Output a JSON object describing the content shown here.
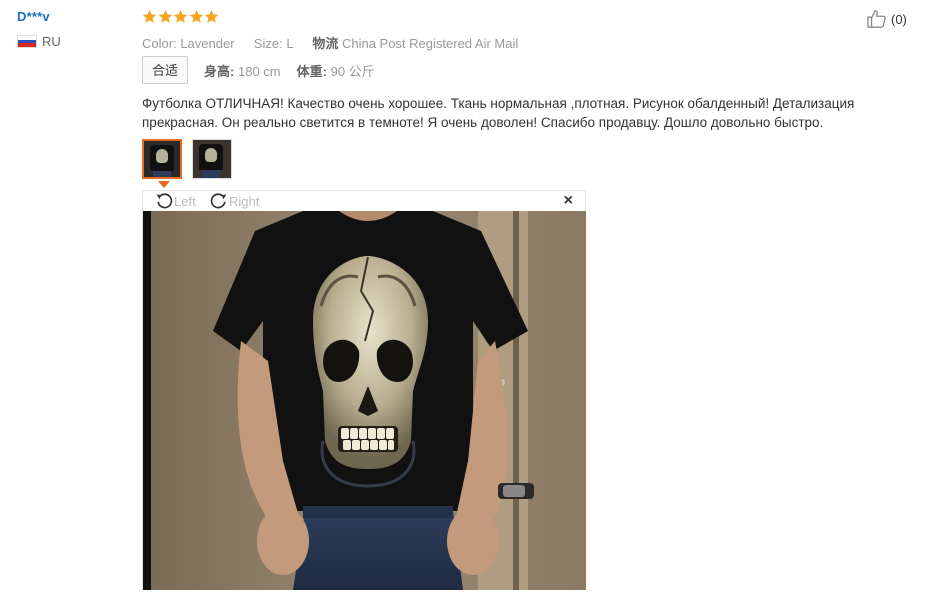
{
  "reviewer": {
    "name": "D***v",
    "country": "RU"
  },
  "rating": {
    "stars": 5,
    "color": "#f5a623"
  },
  "meta": {
    "color_label": "Color:",
    "color_value": "Lavender",
    "size_label": "Size:",
    "size_value": "L",
    "shipping_label": "物流",
    "shipping_value": "China Post Registered Air Mail"
  },
  "fit": {
    "tag": "合适",
    "height_label": "身高:",
    "height_value": "180 cm",
    "weight_label": "体重:",
    "weight_value": "90 公斤"
  },
  "helpful": {
    "count": "(0)"
  },
  "review_text": "Футболка ОТЛИЧНАЯ! Качество очень хорошее. Ткань нормальная ,плотная. Рисунок обалденный! Детализация прекрасная. Он реально светится в темноте! Я очень доволен! Спасибо продавцу. Дошло довольно быстро.",
  "viewer": {
    "rotate_left": "Left",
    "rotate_right": "Right",
    "close": "×"
  },
  "accent_color": "#e76a1f"
}
